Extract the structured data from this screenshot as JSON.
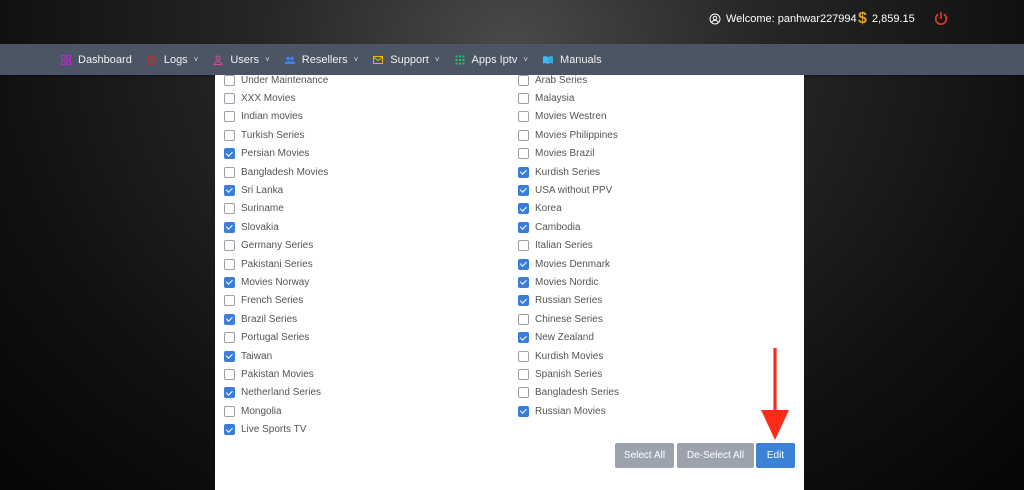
{
  "header": {
    "welcome_text": "Welcome: panhwar227994",
    "balance": "2,859.15"
  },
  "nav": [
    {
      "label": "Dashboard",
      "icon": "dashboard-icon",
      "color": "#c026d3",
      "caret": false
    },
    {
      "label": "Logs",
      "icon": "clock-icon",
      "color": "#dc2626",
      "caret": true
    },
    {
      "label": "Users",
      "icon": "user-icon",
      "color": "#ec4899",
      "caret": true
    },
    {
      "label": "Resellers",
      "icon": "users-icon",
      "color": "#3b82f6",
      "caret": true
    },
    {
      "label": "Support",
      "icon": "envelope-icon",
      "color": "#eab308",
      "caret": true
    },
    {
      "label": "Apps Iptv",
      "icon": "grid-icon",
      "color": "#22c55e",
      "caret": true
    },
    {
      "label": "Manuals",
      "icon": "book-icon",
      "color": "#38bdf8",
      "caret": false
    }
  ],
  "categories_left": [
    {
      "label": "Under Maintenance",
      "checked": false
    },
    {
      "label": "XXX Movies",
      "checked": false
    },
    {
      "label": "Indian movies",
      "checked": false
    },
    {
      "label": "Turkish Series",
      "checked": false
    },
    {
      "label": "Persian Movies",
      "checked": true
    },
    {
      "label": "Bangladesh Movies",
      "checked": false
    },
    {
      "label": "Sri Lanka",
      "checked": true
    },
    {
      "label": "Suriname",
      "checked": false
    },
    {
      "label": "Slovakia",
      "checked": true
    },
    {
      "label": "Germany Series",
      "checked": false
    },
    {
      "label": "Pakistani Series",
      "checked": false
    },
    {
      "label": "Movies Norway",
      "checked": true
    },
    {
      "label": "French Series",
      "checked": false
    },
    {
      "label": "Brazil Series",
      "checked": true
    },
    {
      "label": "Portugal Series",
      "checked": false
    },
    {
      "label": "Taiwan",
      "checked": true
    },
    {
      "label": "Pakistan Movies",
      "checked": false
    },
    {
      "label": "Netherland Series",
      "checked": true
    },
    {
      "label": "Mongolia",
      "checked": false
    },
    {
      "label": "Live Sports TV",
      "checked": true
    }
  ],
  "categories_right": [
    {
      "label": "Arab Series",
      "checked": false
    },
    {
      "label": "Malaysia",
      "checked": false
    },
    {
      "label": "Movies Westren",
      "checked": false
    },
    {
      "label": "Movies Philippines",
      "checked": false
    },
    {
      "label": "Movies Brazil",
      "checked": false
    },
    {
      "label": "Kurdish Series",
      "checked": true
    },
    {
      "label": "USA without PPV",
      "checked": true
    },
    {
      "label": "Korea",
      "checked": true
    },
    {
      "label": "Cambodia",
      "checked": true
    },
    {
      "label": "Italian Series",
      "checked": false
    },
    {
      "label": "Movies Denmark",
      "checked": true
    },
    {
      "label": "Movies Nordic",
      "checked": true
    },
    {
      "label": "Russian Series",
      "checked": true
    },
    {
      "label": "Chinese Series",
      "checked": false
    },
    {
      "label": "New Zealand",
      "checked": true
    },
    {
      "label": "Kurdish Movies",
      "checked": false
    },
    {
      "label": "Spanish Series",
      "checked": false
    },
    {
      "label": "Bangladesh Series",
      "checked": false
    },
    {
      "label": "Russian Movies",
      "checked": true
    }
  ],
  "buttons": {
    "select_all": "Select All",
    "deselect_all": "De-Select All",
    "edit": "Edit"
  },
  "colors": {
    "accent": "#3b82d6",
    "arrow": "#ff2a1a",
    "power": "#e53935"
  }
}
